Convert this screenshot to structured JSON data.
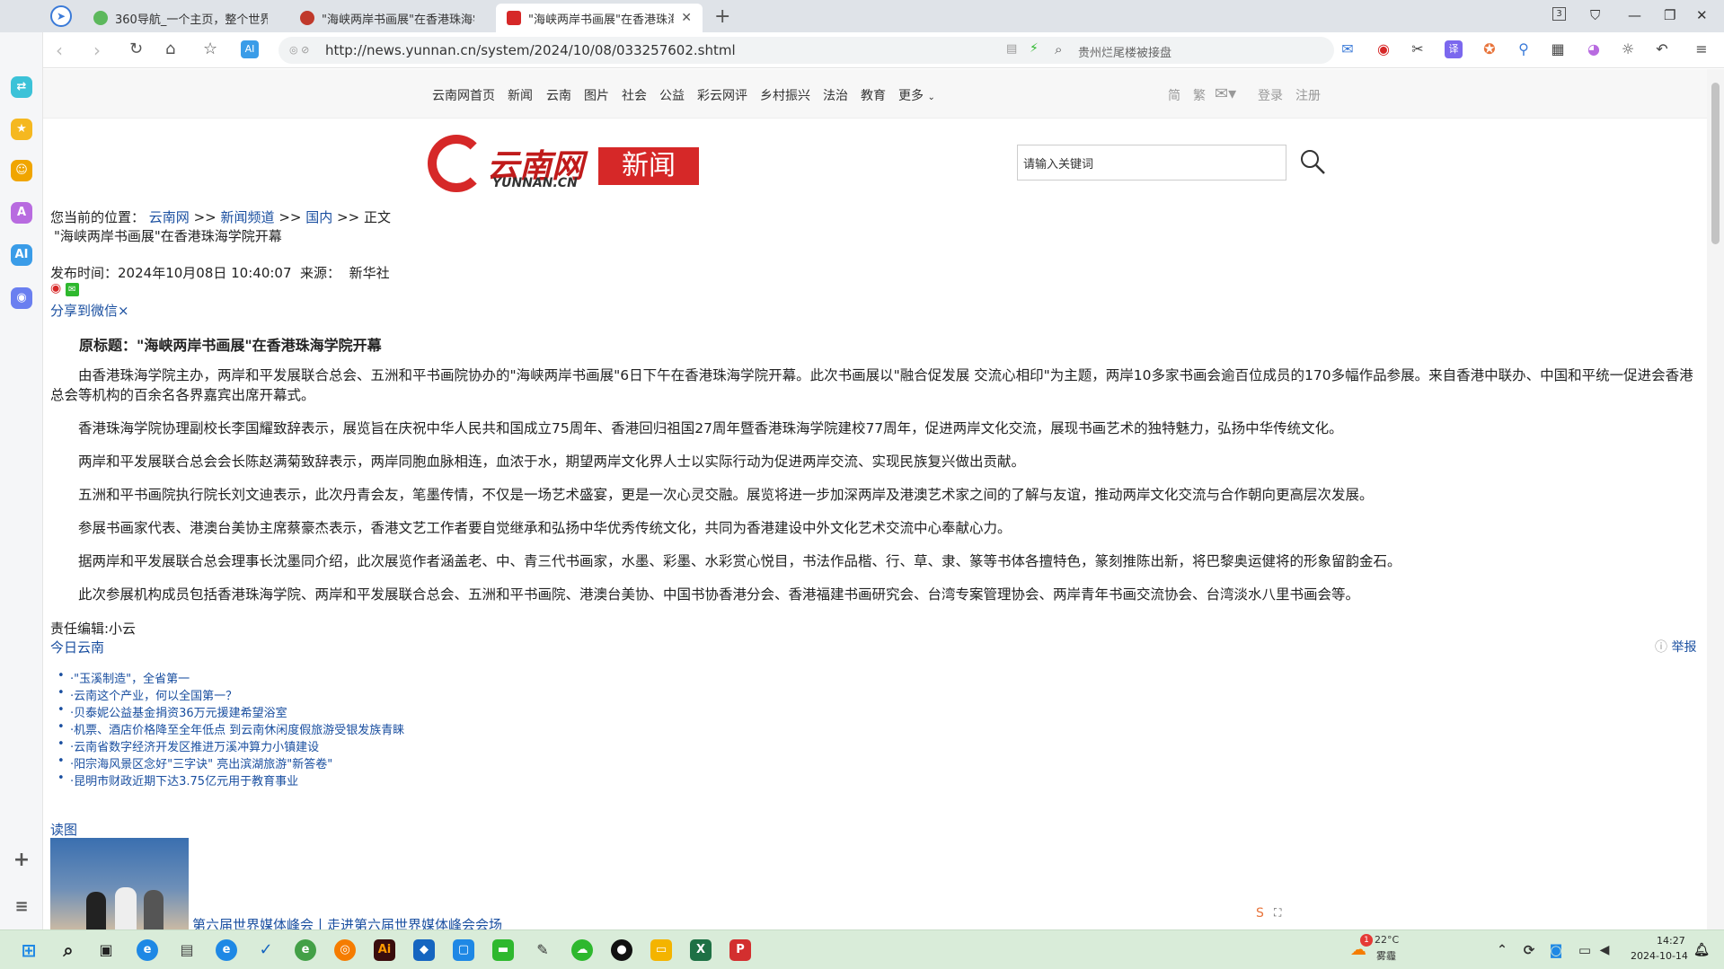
{
  "browser": {
    "tabs": [
      {
        "label": "360导航_一个主页，整个世界"
      },
      {
        "label": "\"海峡两岸书画展\"在香港珠海学"
      },
      {
        "label": "\"海峡两岸书画展\"在香港珠海学"
      }
    ],
    "close_tab": "✕",
    "new_tab": "+",
    "tab_count": "3",
    "url": "http://news.yunnan.cn/system/2024/10/08/033257602.shtml",
    "search_placeholder": "贵州烂尾楼被接盘"
  },
  "site": {
    "nav": [
      "云南网首页",
      "新闻",
      "云南",
      "图片",
      "社会",
      "公益",
      "彩云网评",
      "乡村振兴",
      "法治",
      "教育",
      "更多"
    ],
    "nav_right": {
      "simplified": "简",
      "traditional": "繁",
      "login": "登录",
      "register": "注册"
    },
    "logo": {
      "name": "云南网",
      "latin": "YUNNAN.CN",
      "section": "新闻"
    },
    "search_placeholder": "请输入关键词"
  },
  "breadcrumb": {
    "prefix": "您当前的位置：",
    "items": [
      "云南网",
      "新闻频道",
      "国内"
    ],
    "sep": ">>",
    "current": "正文"
  },
  "article": {
    "title": "\"海峡两岸书画展\"在香港珠海学院开幕",
    "publish_label": "发布时间：",
    "publish_time": "2024年10月08日 10:40:07",
    "source_label": "来源：",
    "source": "新华社",
    "share_wechat": "分享到微信×",
    "original_title": "原标题：\"海峡两岸书画展\"在香港珠海学院开幕",
    "paragraphs": [
      "由香港珠海学院主办，两岸和平发展联合总会、五洲和平书画院协办的\"海峡两岸书画展\"6日下午在香港珠海学院开幕。此次书画展以\"融合促发展 交流心相印\"为主题，两岸10多家书画会逾百位成员的170多幅作品参展。来自香港中联办、中国和平统一促进会香港总会等机构的百余名各界嘉宾出席开幕式。",
      "香港珠海学院协理副校长李国耀致辞表示，展览旨在庆祝中华人民共和国成立75周年、香港回归祖国27周年暨香港珠海学院建校77周年，促进两岸文化交流，展现书画艺术的独特魅力，弘扬中华传统文化。",
      "两岸和平发展联合总会会长陈赵满菊致辞表示，两岸同胞血脉相连，血浓于水，期望两岸文化界人士以实际行动为促进两岸交流、实现民族复兴做出贡献。",
      "五洲和平书画院执行院长刘文迪表示，此次丹青会友，笔墨传情，不仅是一场艺术盛宴，更是一次心灵交融。展览将进一步加深两岸及港澳艺术家之间的了解与友谊，推动两岸文化交流与合作朝向更高层次发展。",
      "参展书画家代表、港澳台美协主席蔡豪杰表示，香港文艺工作者要自觉继承和弘扬中华优秀传统文化，共同为香港建设中外文化艺术交流中心奉献心力。",
      "据两岸和平发展联合总会理事长沈墨同介绍，此次展览作者涵盖老、中、青三代书画家，水墨、彩墨、水彩赏心悦目，书法作品楷、行、草、隶、篆等书体各擅特色，篆刻推陈出新，将巴黎奥运健将的形象留韵金石。",
      "此次参展机构成员包括香港珠海学院、两岸和平发展联合总会、五洲和平书画院、港澳台美协、中国书协香港分会、香港福建书画研究会、台湾专案管理协会、两岸青年书画交流协会、台湾淡水八里书画会等。"
    ],
    "editor": "责任编辑:小云",
    "report": "举报"
  },
  "related": {
    "heading": "今日云南",
    "items": [
      "·\"玉溪制造\"，全省第一",
      "·云南这个产业，何以全国第一？",
      "·贝泰妮公益基金捐资36万元援建希望浴室",
      "·机票、酒店价格降至全年低点 到云南休闲度假旅游受银发族青睐",
      "·云南省数字经济开发区推进万溪冲算力小镇建设",
      "·阳宗海风景区念好\"三字诀\" 亮出滨湖旅游\"新答卷\"",
      "·昆明市财政近期下达3.75亿元用于教育事业"
    ]
  },
  "read_pic": {
    "heading": "读图",
    "caption": "第六届世界媒体峰会丨走进第六届世界媒体峰会会场"
  },
  "taskbar": {
    "weather_temp": "22°C",
    "weather_desc": "雾霾",
    "weather_badge": "1",
    "time": "14:27",
    "date": "2024-10-14"
  },
  "colors": {
    "brand_red": "#d62828",
    "link_blue": "#1a4fa0",
    "taskbar": "#d9ecd9"
  }
}
